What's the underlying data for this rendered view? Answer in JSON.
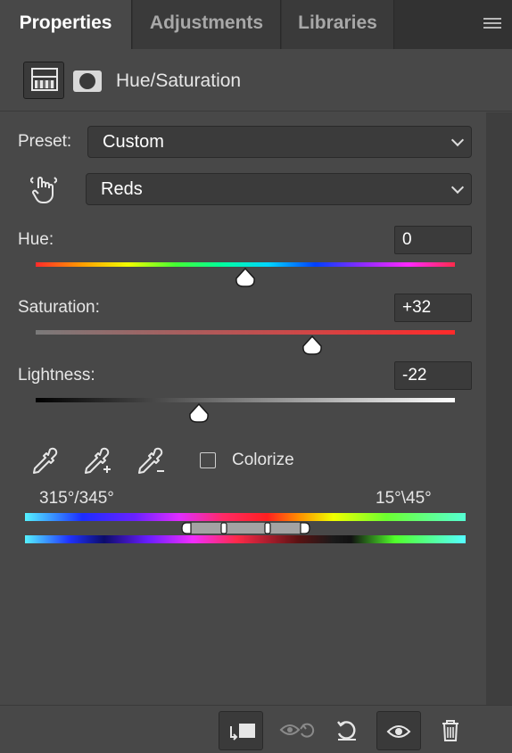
{
  "tabs": [
    {
      "label": "Properties",
      "active": true
    },
    {
      "label": "Adjustments",
      "active": false
    },
    {
      "label": "Libraries",
      "active": false
    }
  ],
  "panel": {
    "title": "Hue/Saturation"
  },
  "preset": {
    "label": "Preset:",
    "value": "Custom"
  },
  "channel": {
    "value": "Reds"
  },
  "hue": {
    "label": "Hue:",
    "value": "0",
    "slider_fraction": 0.5
  },
  "saturation": {
    "label": "Saturation:",
    "value": "+32",
    "slider_fraction": 0.66
  },
  "lightness": {
    "label": "Lightness:",
    "value": "-22",
    "slider_fraction": 0.39
  },
  "colorize": {
    "label": "Colorize",
    "checked": false
  },
  "range": {
    "left": "315°/345°",
    "right": "15°\\45°"
  },
  "icons": {
    "menu": "hamburger-menu-icon",
    "adjustment": "hue-saturation-icon",
    "mask": "mask-icon",
    "hand": "targeted-adjustment-hand-icon",
    "eyedropper": "eyedropper-icon",
    "eyedropper_add": "eyedropper-plus-icon",
    "eyedropper_sub": "eyedropper-minus-icon",
    "clip": "clip-to-layer-icon",
    "view_previous": "view-previous-state-icon",
    "reset": "reset-icon",
    "visibility": "eye-icon",
    "delete": "trash-icon"
  }
}
